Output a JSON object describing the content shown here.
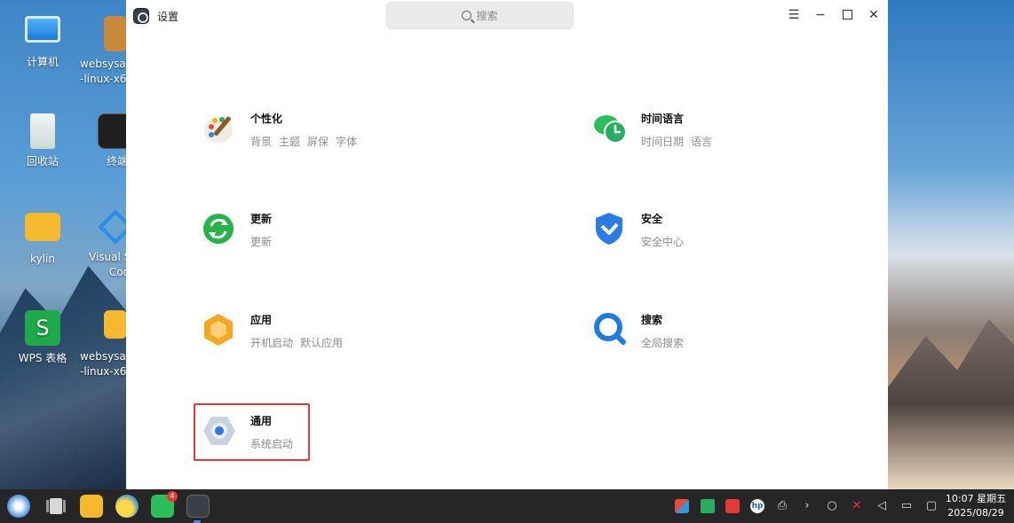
{
  "desktop": {
    "icons": [
      {
        "label": "计算机"
      },
      {
        "label": "websysa\n-linux-x6"
      },
      {
        "label": "回收站"
      },
      {
        "label": "终端"
      },
      {
        "label": "kylin"
      },
      {
        "label": "Visual S\nCod"
      },
      {
        "label": "WPS 表格"
      },
      {
        "label": "websysa\n-linux-x6"
      }
    ]
  },
  "window": {
    "title": "设置",
    "search_placeholder": "搜索",
    "controls": {
      "menu": "☰",
      "minimize": "−",
      "close": "✕"
    }
  },
  "tiles": [
    {
      "title": "个性化",
      "subs": [
        "背景",
        "主题",
        "屏保",
        "字体"
      ]
    },
    {
      "title": "时间语言",
      "subs": [
        "时间日期",
        "语言"
      ]
    },
    {
      "title": "更新",
      "subs": [
        "更新"
      ]
    },
    {
      "title": "安全",
      "subs": [
        "安全中心"
      ]
    },
    {
      "title": "应用",
      "subs": [
        "开机启动",
        "默认应用"
      ]
    },
    {
      "title": "搜索",
      "subs": [
        "全局搜索"
      ]
    },
    {
      "title": "通用",
      "subs": [
        "系统启动"
      ]
    }
  ],
  "taskbar": {
    "clock_time": "10:07 星期五",
    "clock_date": "2025/08/29",
    "badge_count": "4",
    "chevron": "›"
  },
  "colors": {
    "highlight": "#e03a3a",
    "taskbar": "#262626"
  }
}
